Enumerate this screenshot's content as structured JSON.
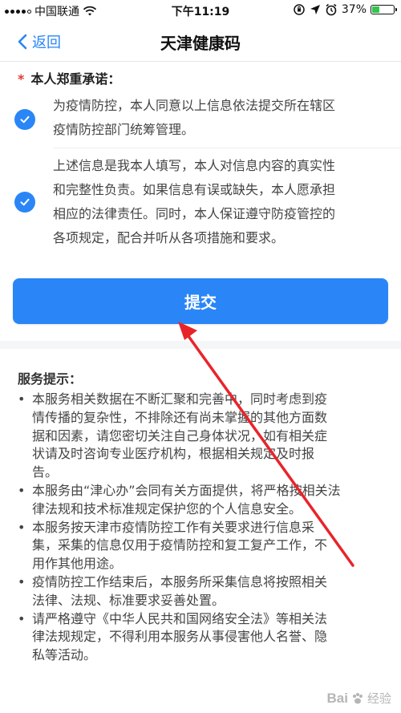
{
  "status_bar": {
    "carrier": "中国联通",
    "time": "下午11:19",
    "battery_text": "37%",
    "battery_level": 0.37,
    "battery_color": "#33c54a"
  },
  "nav": {
    "back_label": "返回",
    "title": "天津健康码"
  },
  "promise": {
    "star": "*",
    "heading": "本人郑重承诺：",
    "items": [
      {
        "lines": [
          "为疫情防控，本人同意以上信息依法提交所在辖区",
          "疫情防控部门统筹管理。"
        ],
        "checked": true
      },
      {
        "lines": [
          "上述信息是我本人填写，本人对信息内容的真实性",
          "和完整性负责。如果信息有误或缺失，本人愿承担",
          "相应的法律责任。同时，本人保证遵守防疫管控的",
          "各项规定，配合并听从各项措施和要求。"
        ],
        "checked": true
      }
    ]
  },
  "submit": {
    "label": "提交"
  },
  "tips": {
    "title": "服务提示：",
    "items": [
      {
        "lines": [
          "本服务相关数据在不断汇聚和完善中，同时考虑到疫",
          "情传播的复杂性，不排除还有尚未掌握的其他方面数",
          "据和因素，请您密切关注自己身体状况，如有相关症",
          "状请及时咨询专业医疗机构，根据相关规定及时报",
          "告。"
        ]
      },
      {
        "lines": [
          "本服务由“津心办”会同有关方面提供，将严格按相关法",
          "律法规和技术标准规定保护您的个人信息安全。"
        ]
      },
      {
        "lines": [
          "本服务按天津市疫情防控工作有关要求进行信息采",
          "集，采集的信息仅用于疫情防控和复工复产工作，不",
          "用作其他用途。"
        ]
      },
      {
        "lines": [
          "疫情防控工作结束后，本服务所采集信息将按照相关",
          "法律、法规、标准要求妥善处置。"
        ]
      },
      {
        "lines": [
          "请严格遵守《中华人民共和国网络安全法》等相关法",
          "律法规规定，不得利用本服务从事侵害他人名誉、隐",
          "私等活动。"
        ]
      }
    ]
  },
  "watermark": {
    "logo": "Bai",
    "suffix": "经验"
  },
  "colors": {
    "accent": "#2a86f6",
    "arrow": "#e8242b",
    "required_star": "#e53935"
  }
}
